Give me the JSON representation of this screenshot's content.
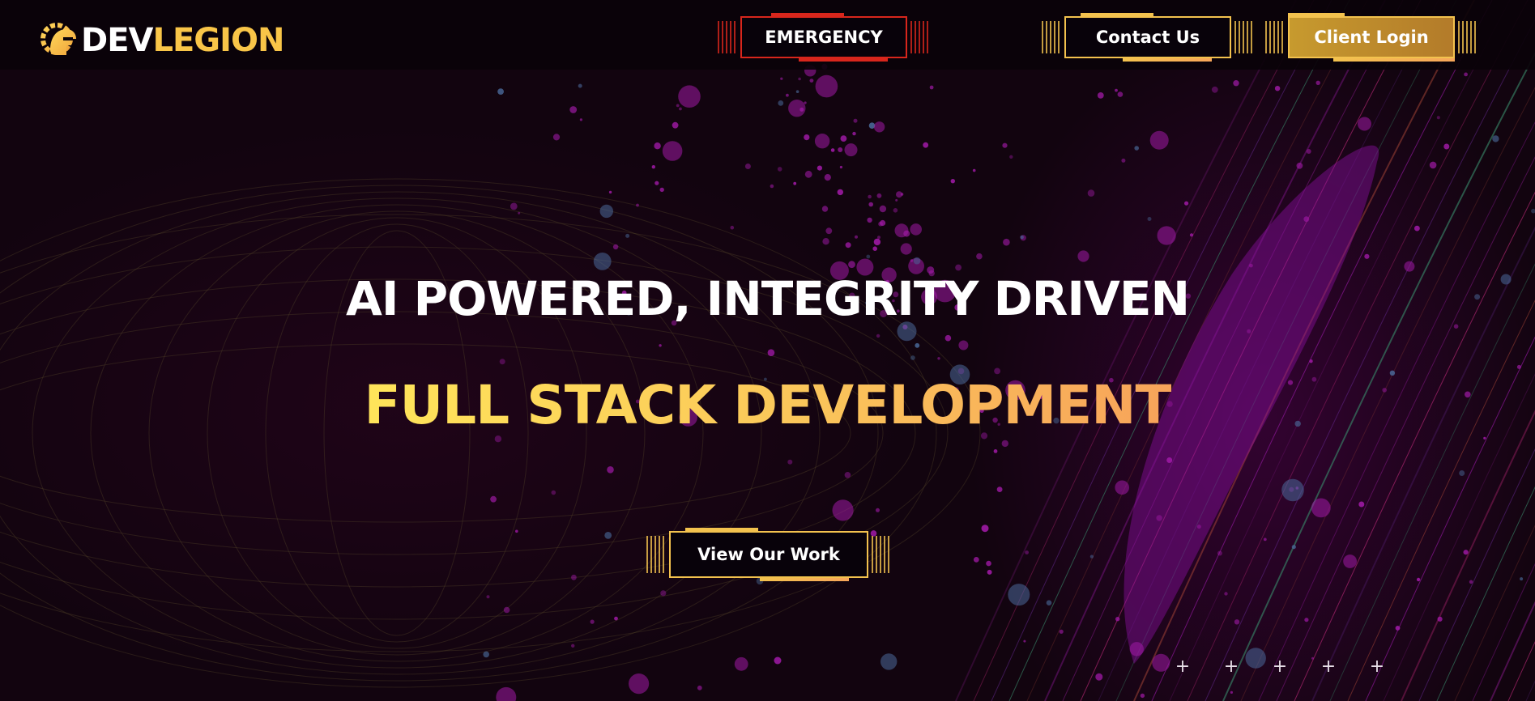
{
  "brand": {
    "name_part1": "DEV",
    "name_part2": "LEGION",
    "logo_icon": "spartan-helmet-gear-icon"
  },
  "header": {
    "emergency_label": "EMERGENCY",
    "contact_label": "Contact Us",
    "login_label": "Client Login"
  },
  "hero": {
    "title": "AI POWERED, INTEGRITY DRIVEN",
    "subtitle": "FULL STACK DEVELOPMENT",
    "cta_label": "View Our Work"
  },
  "decor": {
    "plus_marks": [
      "+",
      "+",
      "+",
      "+",
      "+"
    ]
  },
  "colors": {
    "background": "#12040f",
    "accent_gold": "#f3c24e",
    "accent_orange": "#f7a35a",
    "emergency_red": "#d8261c",
    "particle_magenta": "#a01aa6"
  }
}
